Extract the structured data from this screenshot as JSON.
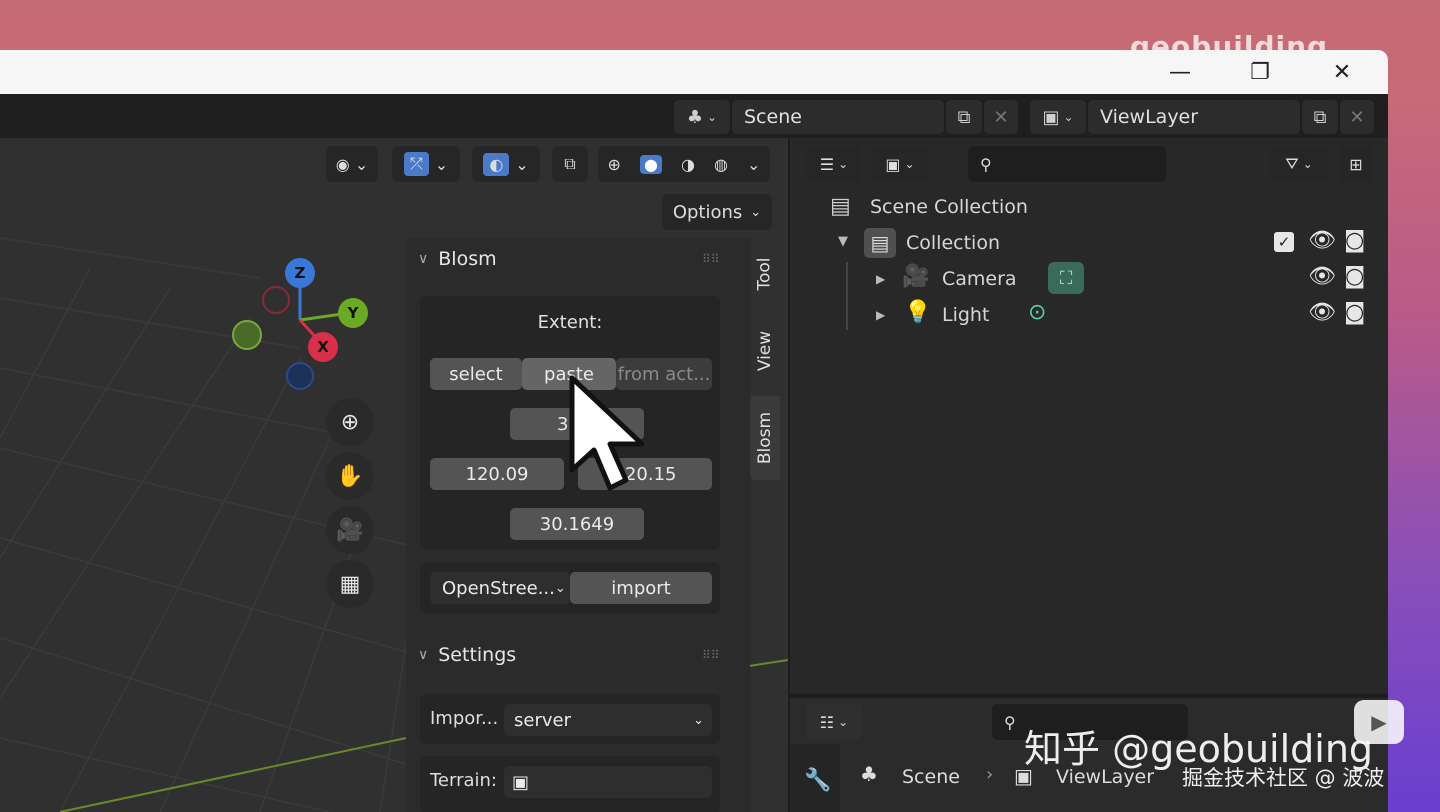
{
  "window": {
    "minimize": "—",
    "restore": "❐",
    "close": "✕",
    "watermark_top": "geobuilding"
  },
  "topbar": {
    "scene_label": "Scene",
    "viewlayer_label": "ViewLayer"
  },
  "viewport": {
    "options_label": "Options",
    "gizmo": {
      "z": "Z",
      "y": "Y",
      "x": "X"
    }
  },
  "npanel": {
    "tabs": [
      "Tool",
      "View",
      "Blosm"
    ],
    "blosm": {
      "title": "Blosm",
      "extent_label": "Extent:",
      "select": "select",
      "paste": "paste",
      "from_active": "from act...",
      "max_lat": "30.1",
      "min_lon": "120.09",
      "max_lon": "120.15",
      "min_lat": "30.1649",
      "source_select": "OpenStree...",
      "import": "import"
    },
    "settings": {
      "title": "Settings",
      "import_label": "Impor...",
      "import_value": "server",
      "terrain_label": "Terrain:"
    }
  },
  "outliner": {
    "rows": [
      {
        "label": "Scene Collection"
      },
      {
        "label": "Collection"
      },
      {
        "label": "Camera"
      },
      {
        "label": "Light"
      }
    ]
  },
  "properties": {
    "breadcrumb_scene": "Scene",
    "breadcrumb_viewlayer": "ViewLayer"
  },
  "overlay": {
    "zhihu": "知乎 @geobuilding",
    "juejin": "掘金技术社区 @ 波波"
  }
}
